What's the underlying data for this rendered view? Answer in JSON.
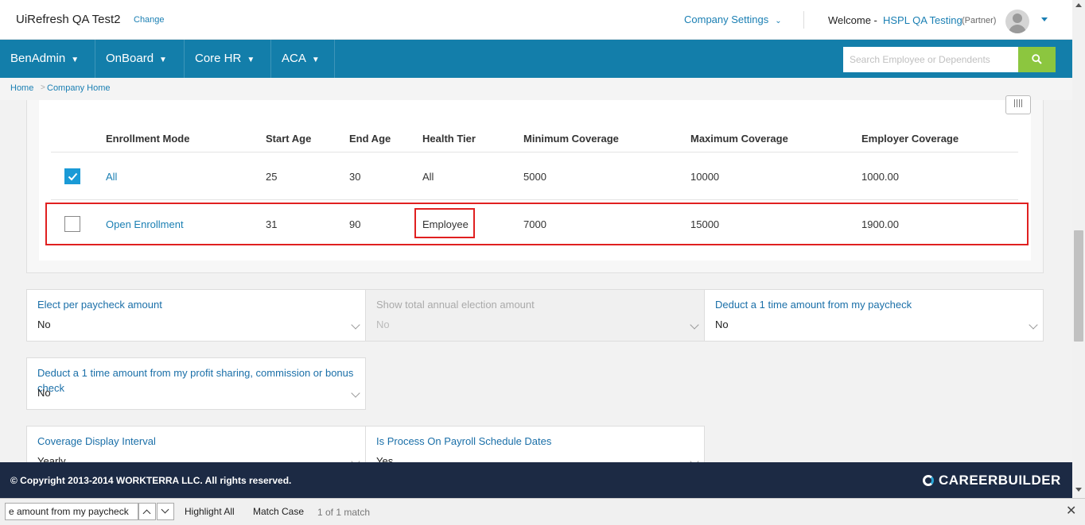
{
  "header": {
    "company_name": "UiRefresh QA Test2",
    "change_label": "Change",
    "company_settings_label": "Company Settings",
    "welcome_label": "Welcome -",
    "user_name": "HSPL QA Testing",
    "user_role": "(Partner)"
  },
  "nav": {
    "items": [
      {
        "label": "BenAdmin"
      },
      {
        "label": "OnBoard"
      },
      {
        "label": "Core HR"
      },
      {
        "label": "ACA"
      }
    ],
    "search_placeholder": "Search Employee or Dependents"
  },
  "breadcrumb": {
    "home": "Home",
    "separator": ">",
    "current": "Company Home"
  },
  "table": {
    "columns": [
      "Enrollment Mode",
      "Start Age",
      "End Age",
      "Health Tier",
      "Minimum Coverage",
      "Maximum Coverage",
      "Employer Coverage"
    ],
    "rows": [
      {
        "checked": true,
        "enrollment_mode": "All",
        "start_age": "25",
        "end_age": "30",
        "health_tier": "All",
        "min_coverage": "5000",
        "max_coverage": "10000",
        "employer_coverage": "1000.00"
      },
      {
        "checked": false,
        "enrollment_mode": "Open Enrollment",
        "start_age": "31",
        "end_age": "90",
        "health_tier": "Employee",
        "min_coverage": "7000",
        "max_coverage": "15000",
        "employer_coverage": "1900.00"
      }
    ]
  },
  "fields": {
    "elect_per_paycheck": {
      "label": "Elect per paycheck amount",
      "value": "No"
    },
    "show_total_annual": {
      "label": "Show total annual election amount",
      "value": "No"
    },
    "deduct_one_time_paycheck": {
      "label": "Deduct a 1 time amount from my paycheck",
      "value": "No"
    },
    "deduct_one_time_profit": {
      "label": "Deduct a 1 time amount from my profit sharing, commission or bonus check",
      "value": "No"
    },
    "coverage_display_interval": {
      "label": "Coverage Display Interval",
      "value": "Yearly"
    },
    "process_on_payroll": {
      "label": "Is Process On Payroll Schedule Dates",
      "value": "Yes"
    }
  },
  "footer": {
    "copyright": "© Copyright 2013-2014 WORKTERRA LLC. All rights reserved.",
    "brand": "CAREERBUILDER"
  },
  "findbar": {
    "query": "e amount from my paycheck",
    "highlight_all": "Highlight All",
    "match_case": "Match Case",
    "status": "1 of 1 match"
  },
  "colors": {
    "nav_bg": "#137eaa",
    "link": "#1a7fb3",
    "search_button": "#8cc63f",
    "footer_bg": "#1c2a44",
    "highlight_border": "#e02020"
  }
}
